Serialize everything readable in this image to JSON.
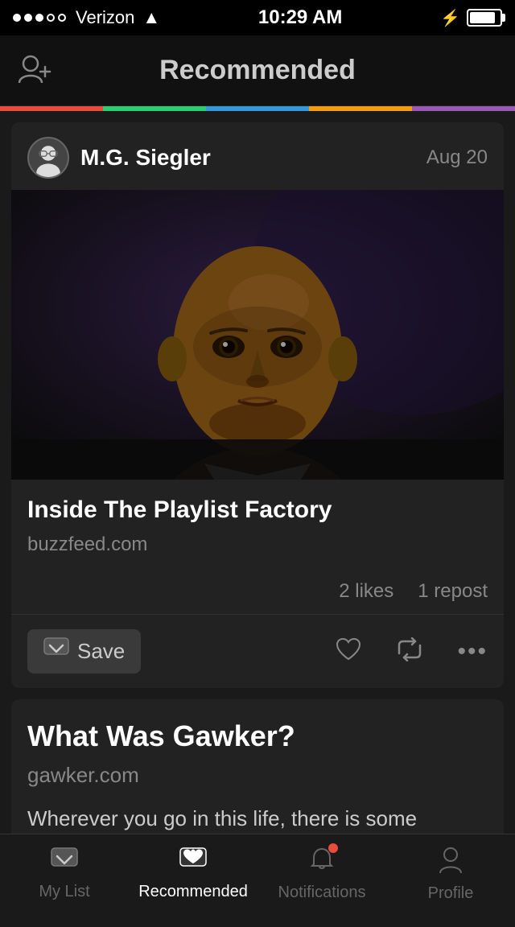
{
  "statusBar": {
    "carrier": "Verizon",
    "time": "10:29 AM",
    "signal": "●●●○○"
  },
  "header": {
    "title": "Recommended",
    "addUserLabel": "Add User"
  },
  "colorBar": {
    "colors": [
      "#e74c3c",
      "#2ecc71",
      "#3498db",
      "#f39c12",
      "#9b59b6"
    ]
  },
  "card1": {
    "authorName": "M.G. Siegler",
    "date": "Aug 20",
    "articleTitle": "Inside The Playlist Factory",
    "articleSource": "buzzfeed.com",
    "likes": "2 likes",
    "reposts": "1 repost",
    "saveLabel": "Save"
  },
  "card2": {
    "articleTitle": "What Was Gawker?",
    "articleSource": "gawker.com",
    "excerpt": "Wherever you go in this life, there is some"
  },
  "tabBar": {
    "myList": "My List",
    "recommended": "Recommended",
    "notifications": "Notifications",
    "profile": "Profile"
  }
}
